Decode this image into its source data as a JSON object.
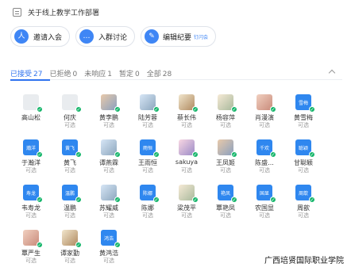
{
  "header": {
    "title": "关于线上教学工作部署"
  },
  "actions": [
    {
      "label": "邀请入会",
      "icon": "人"
    },
    {
      "label": "入群讨论",
      "icon": "…"
    },
    {
      "label": "编辑纪要",
      "icon": "✎",
      "sub": "钉闪会"
    }
  ],
  "tabs": [
    {
      "label": "已接受",
      "count": "27"
    },
    {
      "label": "已拒绝",
      "count": "0"
    },
    {
      "label": "未响应",
      "count": "1"
    },
    {
      "label": "暂定",
      "count": "0"
    },
    {
      "label": "全部",
      "count": "28"
    }
  ],
  "people": [
    {
      "name": "高山松",
      "status": "",
      "avatar": "",
      "type": "gray"
    },
    {
      "name": "何庆",
      "status": "可选",
      "avatar": "",
      "type": "gray"
    },
    {
      "name": "黄李鹏",
      "status": "可选",
      "avatar": "",
      "type": "photo"
    },
    {
      "name": "陆芳蓉",
      "status": "可选",
      "avatar": "",
      "type": "photo5"
    },
    {
      "name": "蔡长伟",
      "status": "可选",
      "avatar": "",
      "type": "photo6"
    },
    {
      "name": "杨容萍",
      "status": "可选",
      "avatar": "",
      "type": "photo3"
    },
    {
      "name": "肖漫演",
      "status": "可选",
      "avatar": "",
      "type": "photo2"
    },
    {
      "name": "黄雪梅",
      "status": "可选",
      "avatar": "雪梅",
      "type": "blue"
    },
    {
      "name": "于瀚洋",
      "status": "可选",
      "avatar": "瀚洋",
      "type": "blue"
    },
    {
      "name": "黄飞",
      "status": "可选",
      "avatar": "黄飞",
      "type": "blue"
    },
    {
      "name": "谭燕霖",
      "status": "可选",
      "avatar": "",
      "type": "photo5"
    },
    {
      "name": "王雨恒",
      "status": "可选",
      "avatar": "雨恒",
      "type": "blue"
    },
    {
      "name": "sakuya",
      "status": "可选",
      "avatar": "",
      "type": "photo4"
    },
    {
      "name": "王凤姬",
      "status": "可选",
      "avatar": "",
      "type": "photo"
    },
    {
      "name": "陈盛...",
      "status": "可选",
      "avatar": "千欢",
      "type": "blue"
    },
    {
      "name": "甘聪颖",
      "status": "可选",
      "avatar": "聪颖",
      "type": "blue"
    },
    {
      "name": "韦寿龙",
      "status": "可选",
      "avatar": "寿龙",
      "type": "blue"
    },
    {
      "name": "温鹏",
      "status": "可选",
      "avatar": "温鹏",
      "type": "blue"
    },
    {
      "name": "苏耀威",
      "status": "可选",
      "avatar": "",
      "type": "photo5"
    },
    {
      "name": "陈娜",
      "status": "可选",
      "avatar": "陈娜",
      "type": "blue"
    },
    {
      "name": "梁茂平",
      "status": "可选",
      "avatar": "",
      "type": "photo3"
    },
    {
      "name": "覃艳凤",
      "status": "可选",
      "avatar": "艳凤",
      "type": "blue"
    },
    {
      "name": "农国显",
      "status": "可选",
      "avatar": "国显",
      "type": "blue"
    },
    {
      "name": "周歆",
      "status": "可选",
      "avatar": "周歆",
      "type": "blue"
    },
    {
      "name": "覃严生",
      "status": "可选",
      "avatar": "",
      "type": "photo2"
    },
    {
      "name": "谭家勤",
      "status": "可选",
      "avatar": "",
      "type": "photo6"
    },
    {
      "name": "黄鸿浩",
      "status": "可选",
      "avatar": "鸿浩",
      "type": "blue"
    }
  ],
  "watermark": "广西培贤国际职业学院"
}
